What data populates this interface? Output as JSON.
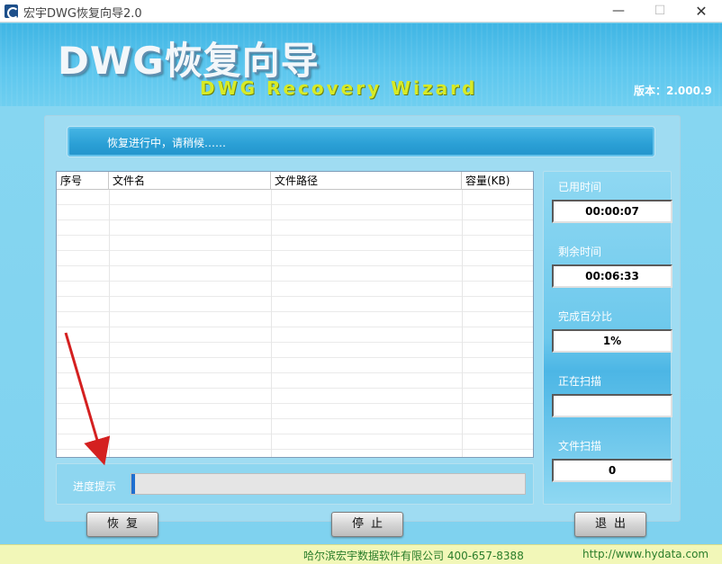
{
  "window": {
    "title": "宏宇DWG恢复向导2.0",
    "minimize_glyph": "—",
    "maximize_glyph": "☐",
    "close_glyph": "✕"
  },
  "banner": {
    "title": "DWG恢复向导",
    "subtitle": "DWG Recovery Wizard",
    "version": "版本：2.000.9"
  },
  "status": {
    "message": "恢复进行中，请稍候……"
  },
  "file_table": {
    "columns": [
      "序号",
      "文件名",
      "文件路径",
      "容量(KB)"
    ],
    "rows": []
  },
  "progress": {
    "label": "进度提示",
    "percent": 1
  },
  "stats": {
    "elapsed_label": "已用时间",
    "elapsed_value": "00:00:07",
    "remaining_label": "剩余时间",
    "remaining_value": "00:06:33",
    "percent_label": "完成百分比",
    "percent_value": "1%",
    "scanning_label": "正在扫描",
    "scanning_value": "",
    "files_label": "文件扫描",
    "files_value": "0"
  },
  "buttons": {
    "recover": "恢复",
    "stop": "停止",
    "exit": "退出"
  },
  "footer": {
    "company": "哈尔滨宏宇数据软件有限公司 400-657-8388",
    "url": "http://www.hydata.com"
  },
  "colors": {
    "banner_blue": "#3fb5e4",
    "subtitle_yellow": "#d7ea26",
    "annotation_red": "#d42020"
  }
}
